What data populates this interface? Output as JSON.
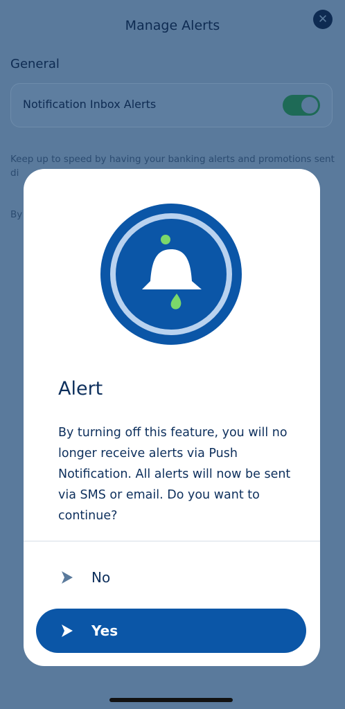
{
  "header": {
    "title": "Manage Alerts",
    "close_icon": "close-icon"
  },
  "general": {
    "section_title": "General",
    "inbox_alerts_label": "Notification Inbox Alerts",
    "inbox_alerts_enabled": true
  },
  "background_text": {
    "description": "Keep up to speed by having your banking alerts and promotions sent di",
    "by_prefix": "By"
  },
  "modal": {
    "icon": "bell-icon",
    "title": "Alert",
    "body": "By turning off this feature, you will no longer receive alerts via Push Notification. All alerts will now be sent via SMS or email. Do you want to continue?",
    "no_label": "No",
    "yes_label": "Yes"
  },
  "colors": {
    "primary": "#0b56a7",
    "accent_green": "#7bd86a",
    "text_dark": "#0d2f5c"
  }
}
